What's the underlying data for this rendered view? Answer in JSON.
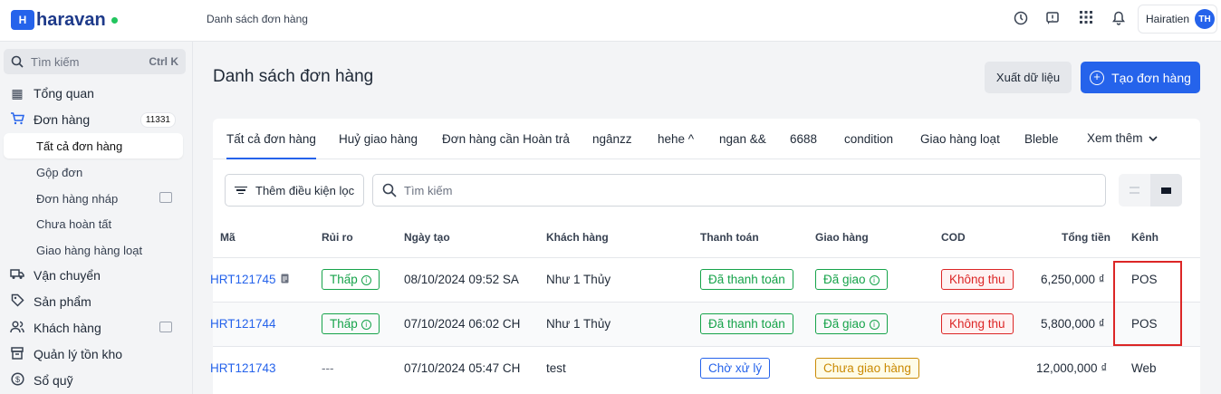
{
  "header": {
    "logo_text": "haravan",
    "breadcrumb": "Danh sách đơn hàng",
    "user_name": "Hairatien",
    "user_initials": "TH"
  },
  "sidebar": {
    "search_placeholder": "Tìm kiếm",
    "search_shortcut": "Ctrl K",
    "items": [
      {
        "label": "Tổng quan",
        "icon": "dashboard-icon"
      },
      {
        "label": "Đơn hàng",
        "icon": "cart-icon",
        "badge": "11331"
      },
      {
        "label": "Tất cả đơn hàng"
      },
      {
        "label": "Gộp đơn"
      },
      {
        "label": "Đơn hàng nháp"
      },
      {
        "label": "Chưa hoàn tất"
      },
      {
        "label": "Giao hàng hàng loạt"
      },
      {
        "label": "Vận chuyển",
        "icon": "truck-icon"
      },
      {
        "label": "Sản phẩm",
        "icon": "tag-icon"
      },
      {
        "label": "Khách hàng",
        "icon": "users-icon"
      },
      {
        "label": "Quản lý tồn kho",
        "icon": "inventory-icon"
      },
      {
        "label": "Sổ quỹ",
        "icon": "cashbook-icon"
      }
    ]
  },
  "main": {
    "title": "Danh sách đơn hàng",
    "export_label": "Xuất dữ liệu",
    "create_label": "Tạo đơn hàng",
    "tabs": [
      "Tất cả đơn hàng",
      "Huỷ giao hàng",
      "Đơn hàng cần Hoàn trả",
      "ngânzz",
      "hehe ^",
      "ngan &&",
      "6688",
      "condition",
      "Giao hàng loạt",
      "Bleble",
      "Xem thêm"
    ],
    "filter_label": "Thêm điều kiện lọc",
    "search_placeholder": "Tìm kiếm"
  },
  "table": {
    "columns": [
      "Mã",
      "Rủi ro",
      "Ngày tạo",
      "Khách hàng",
      "Thanh toán",
      "Giao hàng",
      "COD",
      "Tổng tiền",
      "Kênh"
    ],
    "rows": [
      {
        "code": "HRT121745",
        "risk": "Thấp",
        "date": "08/10/2024 09:52 SA",
        "customer": "Như 1 Thủy",
        "payment": "Đã thanh toán",
        "shipping": "Đã giao",
        "cod": "Không thu",
        "total": "6,250,000 ₫",
        "channel": "POS"
      },
      {
        "code": "HRT121744",
        "risk": "Thấp",
        "date": "07/10/2024 06:02 CH",
        "customer": "Như 1 Thủy",
        "payment": "Đã thanh toán",
        "shipping": "Đã giao",
        "cod": "Không thu",
        "total": "5,800,000 ₫",
        "channel": "POS"
      },
      {
        "code": "HRT121743",
        "risk": "---",
        "date": "07/10/2024 05:47 CH",
        "customer": "test",
        "payment": "Chờ xử lý",
        "shipping": "Chưa giao hàng",
        "cod": "",
        "total": "12,000,000 ₫",
        "channel": "Web"
      }
    ]
  }
}
